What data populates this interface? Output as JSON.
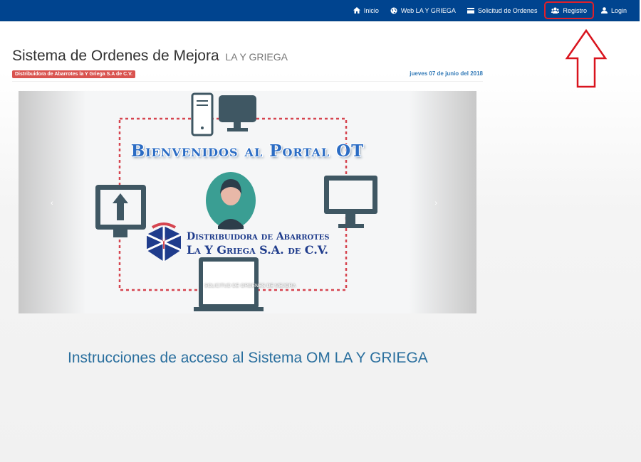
{
  "nav": {
    "items": [
      {
        "label": "Inicio",
        "icon": "home-icon"
      },
      {
        "label": "Web LA Y GRIEGA",
        "icon": "globe-icon"
      },
      {
        "label": "Solicitud de Ordenes",
        "icon": "card-icon"
      },
      {
        "label": "Registro",
        "icon": "users-icon"
      },
      {
        "label": "Login",
        "icon": "user-icon"
      }
    ],
    "highlight_color": "#e0202a"
  },
  "header": {
    "title": "Sistema de Ordenes de Mejora",
    "subtitle": "LA Y GRIEGA",
    "badge": "Distribuidora de Abarrotes la Y Griega S.A de C.V.",
    "date": "jueves 07 de junio del 2018"
  },
  "carousel": {
    "welcome": "Bienvenidos al Portal OT",
    "company_line1": "Distribuidora de Abarrotes",
    "company_line2": "La Y Griega S.A. de C.V.",
    "caption": "SOLICITUD DE ORDENES DE MEJORA",
    "prev_label": "‹",
    "next_label": "›"
  },
  "main": {
    "instructions_title": "Instrucciones de acceso al Sistema OM LA Y GRIEGA"
  },
  "colors": {
    "navbar": "#00448f",
    "badge": "#d9534f",
    "link": "#337ab7",
    "icon_dark": "#3f5763",
    "avatar_bg": "#3a9e93"
  }
}
